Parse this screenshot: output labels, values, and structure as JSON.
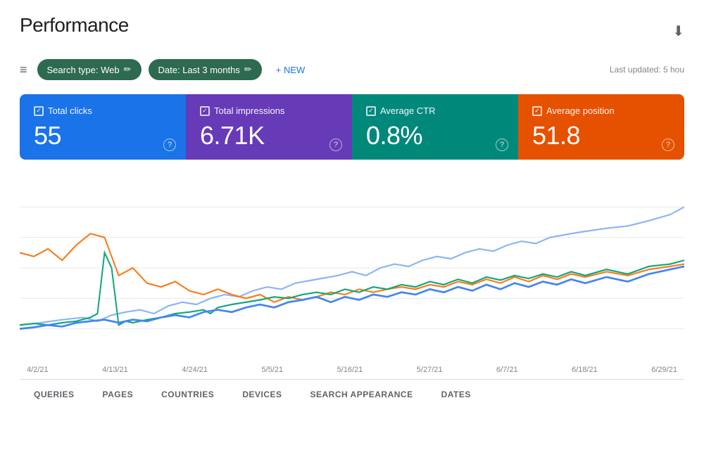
{
  "header": {
    "title": "Performance",
    "export_icon": "⬇"
  },
  "toolbar": {
    "filter_icon": "≡",
    "chips": [
      {
        "label": "Search type: Web",
        "edit_icon": "✏"
      },
      {
        "label": "Date: Last 3 months",
        "edit_icon": "✏"
      }
    ],
    "new_button": "+ NEW",
    "last_updated": "Last updated: 5 hou"
  },
  "metrics": [
    {
      "id": "total-clicks",
      "label": "Total clicks",
      "value": "55",
      "color": "blue",
      "checked": true
    },
    {
      "id": "total-impressions",
      "label": "Total impressions",
      "value": "6.71K",
      "color": "purple",
      "checked": true
    },
    {
      "id": "average-ctr",
      "label": "Average CTR",
      "value": "0.8%",
      "color": "teal",
      "checked": true
    },
    {
      "id": "average-position",
      "label": "Average position",
      "value": "51.8",
      "color": "orange",
      "checked": true
    }
  ],
  "chart": {
    "dates": [
      "4/2/21",
      "4/13/21",
      "4/24/21",
      "5/5/21",
      "5/16/21",
      "5/27/21",
      "6/7/21",
      "6/18/21",
      "6/29/21"
    ],
    "lines": {
      "blue": "light blue - total impressions",
      "orange": "orange - average position",
      "teal": "teal - average CTR",
      "dark_blue": "dark blue - total clicks"
    }
  },
  "bottom_tabs": [
    {
      "label": "QUERIES",
      "active": false
    },
    {
      "label": "PAGES",
      "active": false
    },
    {
      "label": "COUNTRIES",
      "active": false
    },
    {
      "label": "DEVICES",
      "active": false
    },
    {
      "label": "SEARCH APPEARANCE",
      "active": false
    },
    {
      "label": "DATES",
      "active": false
    }
  ]
}
